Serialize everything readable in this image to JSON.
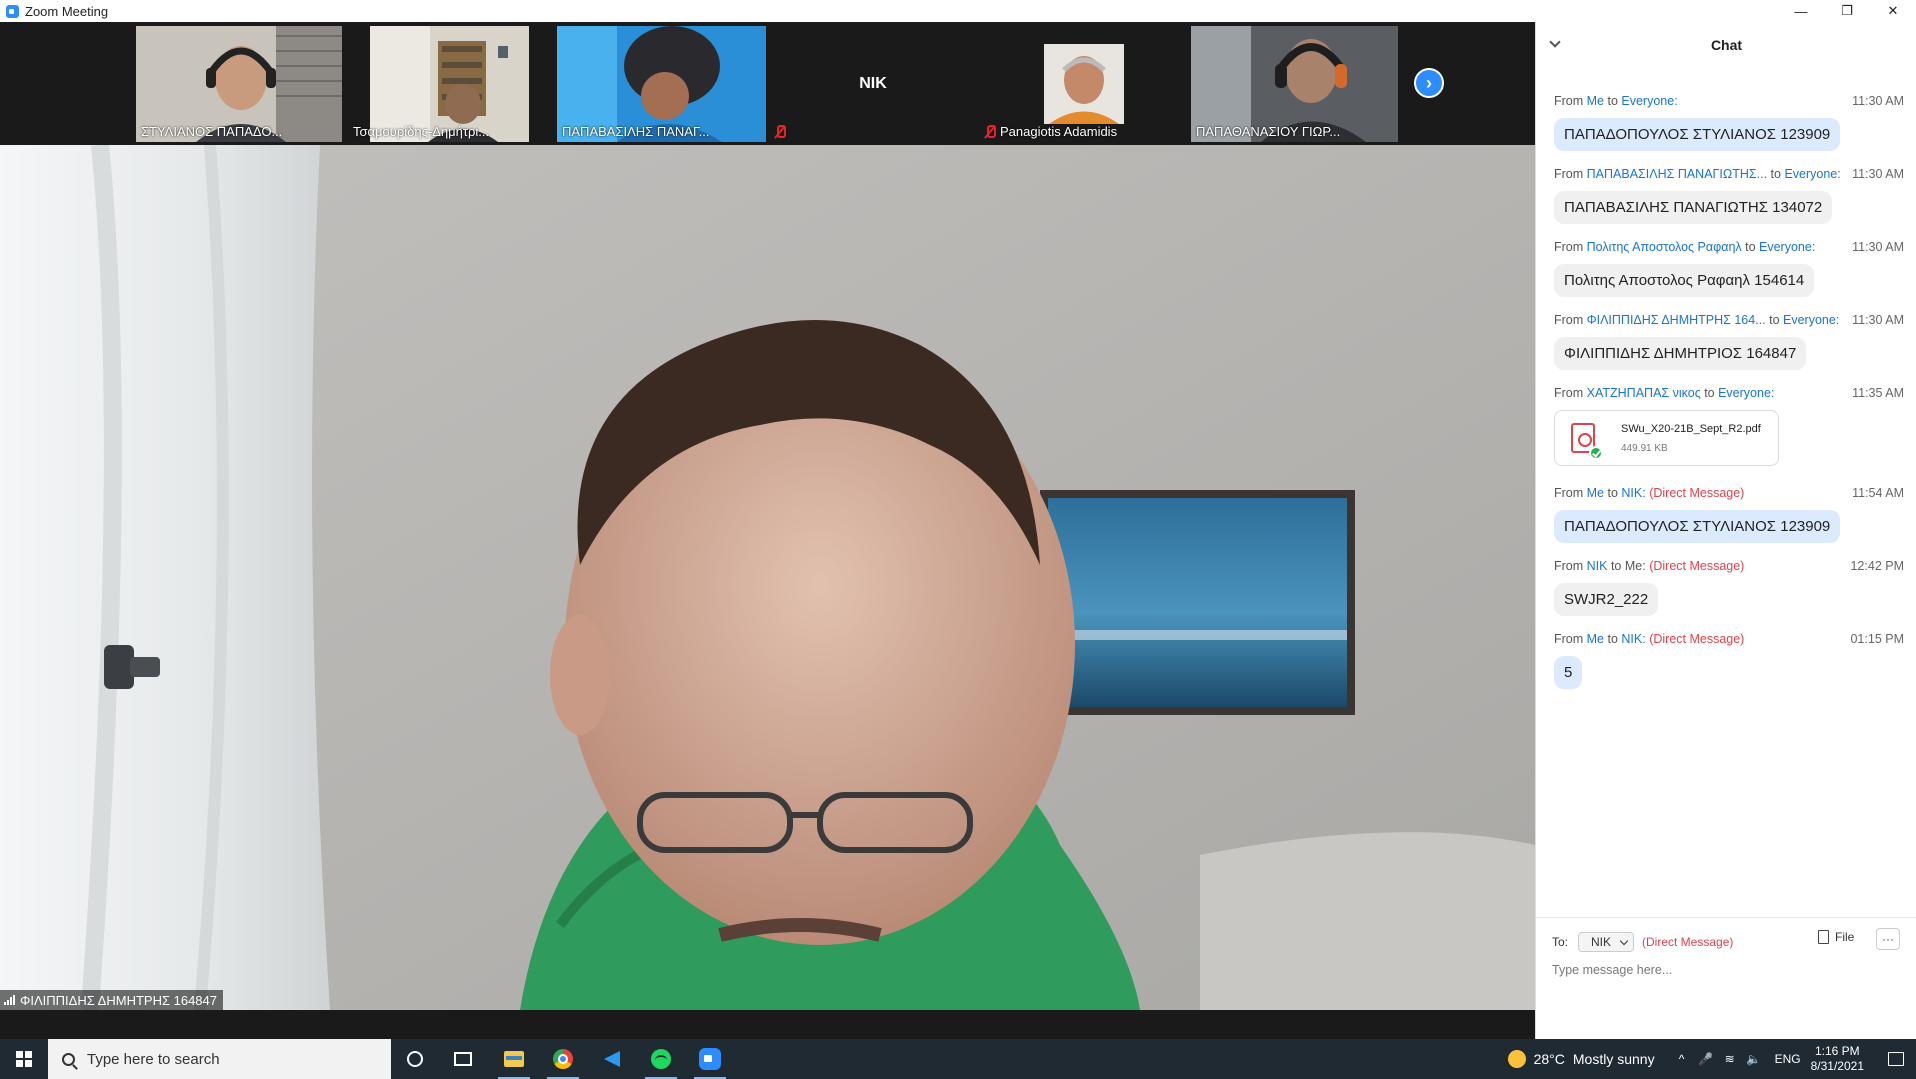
{
  "window": {
    "title": "Zoom Meeting",
    "controls": {
      "minimize": "—",
      "restore": "❐",
      "close": "✕"
    }
  },
  "participants": [
    {
      "name": "ΣΤΥΛΙΑΝΟΣ ΠΑΠΑΔΟ...",
      "muted": false,
      "video": true
    },
    {
      "name": "Τσαμουρίδης-Δημήτρι...",
      "muted": false,
      "video": true
    },
    {
      "name": "ΠΑΠΑΒΑΣΙΛΗΣ ΠΑΝΑΓ...",
      "muted": false,
      "video": true
    },
    {
      "name": "NIK",
      "muted": true,
      "video": false
    },
    {
      "name": "Panagiotis Adamidis",
      "muted": true,
      "video": false
    },
    {
      "name": "ΠΑΠΑΘΑΝΑΣΙΟΥ ΓΙΩΡ...",
      "muted": false,
      "video": true
    }
  ],
  "main_speaker": {
    "name": "ΦΙΛΙΠΠΙΔΗΣ ΔΗΜΗΤΡΗΣ 164847"
  },
  "chat": {
    "title": "Chat",
    "messages": [
      {
        "from": "Me",
        "to": "Everyone:",
        "dm": "",
        "time": "11:30 AM",
        "text": "ΠΑΠΑΔΟΠΟΥΛΟΣ ΣΤΥΛΙΑΝΟΣ 123909",
        "mine": true
      },
      {
        "from": "ΠΑΠΑΒΑΣΙΛΗΣ ΠΑΝΑΓΙΩΤΗΣ...",
        "to": "Everyone:",
        "dm": "",
        "time": "11:30 AM",
        "text": "ΠΑΠΑΒΑΣΙΛΗΣ ΠΑΝΑΓΙΩΤΗΣ 134072",
        "mine": false
      },
      {
        "from": "Πολιτης Αποστολος Ραφαηλ",
        "to": "Everyone:",
        "dm": "",
        "time": "11:30 AM",
        "text": "Πολιτης Αποστολος Ραφαηλ 154614",
        "mine": false
      },
      {
        "from": "ΦΙΛΙΠΠΙΔΗΣ ΔΗΜΗΤΡΗΣ 164...",
        "to": "Everyone:",
        "dm": "",
        "time": "11:30 AM",
        "text": "ΦΙΛΙΠΠΙΔΗΣ ΔΗΜΗΤΡΙΟΣ 164847",
        "mine": false
      },
      {
        "from": "ΧΑΤΖΗΠΑΠΑΣ νικος",
        "to": "Everyone:",
        "dm": "",
        "time": "11:35 AM",
        "file": {
          "name": "SWu_X20-21B_Sept_R2.pdf",
          "size": "449.91 KB"
        }
      },
      {
        "from": "Me",
        "to": "NIK:",
        "dm": "(Direct Message)",
        "time": "11:54 AM",
        "text": "ΠΑΠΑΔΟΠΟΥΛΟΣ ΣΤΥΛΙΑΝΟΣ 123909",
        "mine": true
      },
      {
        "from": "NIK",
        "to": "Me:",
        "dm": "(Direct Message)",
        "time": "12:42 PM",
        "text": "SWJR2_222",
        "mine": false
      },
      {
        "from": "Me",
        "to": "NIK:",
        "dm": "(Direct Message)",
        "time": "01:15 PM",
        "text": "5",
        "mine": true
      }
    ],
    "composer": {
      "to_label": "To:",
      "to_value": "NIK",
      "dm_label": "(Direct Message)",
      "file_label": "File",
      "more_label": "···",
      "placeholder": "Type message here..."
    }
  },
  "taskbar": {
    "search_placeholder": "Type here to search",
    "weather": {
      "temp": "28°C",
      "condition": "Mostly sunny"
    },
    "tray": {
      "chevron": "^",
      "mic": "🎤",
      "wifi": "≋",
      "volume": "🔈",
      "lang": "ENG"
    },
    "clock": {
      "time": "1:16 PM",
      "date": "8/31/2021"
    }
  },
  "colors": {
    "accent": "#2d8cff",
    "link": "#1a73d9",
    "dm": "#e0434b",
    "taskbar": "#1f2a33"
  }
}
